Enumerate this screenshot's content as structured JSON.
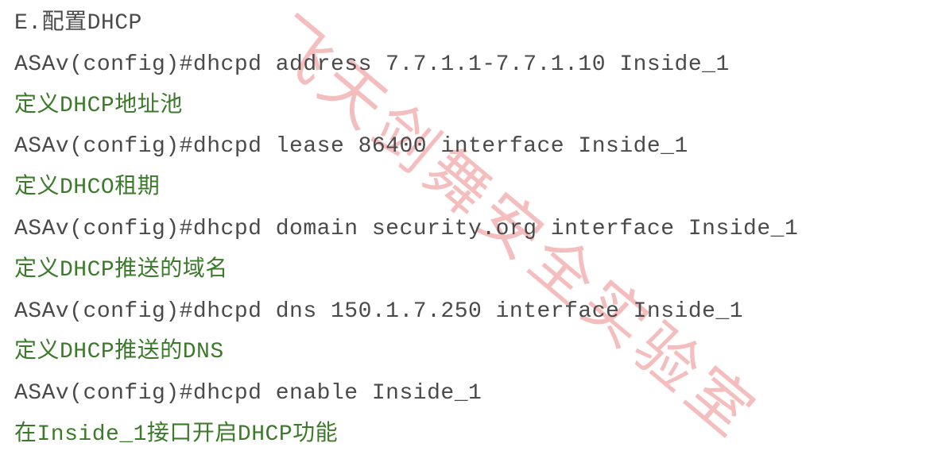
{
  "lines": [
    {
      "type": "cmd",
      "text": "E.配置DHCP"
    },
    {
      "type": "cmd",
      "text": "ASAv(config)#dhcpd address 7.7.1.1-7.7.1.10 Inside_1"
    },
    {
      "type": "comment",
      "text": "定义DHCP地址池"
    },
    {
      "type": "cmd",
      "text": "ASAv(config)#dhcpd lease 86400 interface Inside_1"
    },
    {
      "type": "comment",
      "text": "定义DHCO租期"
    },
    {
      "type": "cmd",
      "text": "ASAv(config)#dhcpd domain security.org interface Inside_1"
    },
    {
      "type": "comment",
      "text": "定义DHCP推送的域名"
    },
    {
      "type": "cmd",
      "text": "ASAv(config)#dhcpd dns 150.1.7.250 interface Inside_1"
    },
    {
      "type": "comment",
      "text": "定义DHCP推送的DNS"
    },
    {
      "type": "cmd",
      "text": "ASAv(config)#dhcpd enable Inside_1"
    },
    {
      "type": "comment",
      "text": "在Inside_1接口开启DHCP功能"
    }
  ],
  "watermark": "飞天剑舞安全实验室"
}
